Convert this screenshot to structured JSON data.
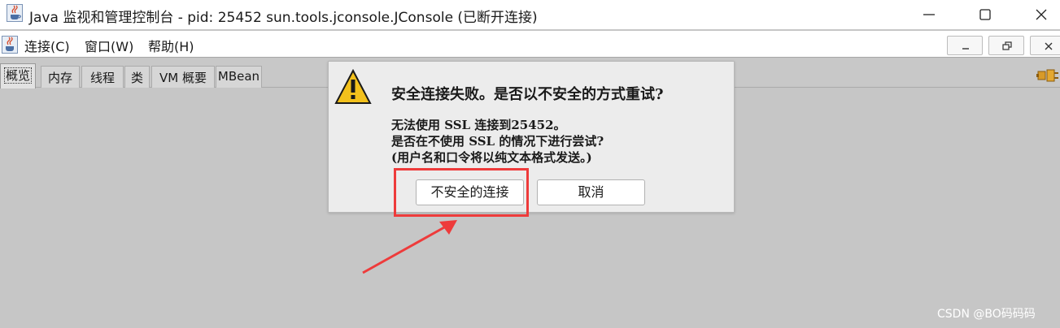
{
  "window": {
    "title": "Java 监视和管理控制台 - pid: 25452 sun.tools.jconsole.JConsole (已断开连接)",
    "app_icon": "java-cup-icon",
    "controls": [
      "minimize-icon",
      "maximize-icon",
      "close-icon"
    ]
  },
  "menubar": {
    "items": [
      {
        "label": "连接(C)"
      },
      {
        "label": "窗口(W)"
      },
      {
        "label": "帮助(H)"
      }
    ]
  },
  "tabs": [
    {
      "label": "概览",
      "active": true
    },
    {
      "label": "内存"
    },
    {
      "label": "线程"
    },
    {
      "label": "类"
    },
    {
      "label": "VM 概要"
    },
    {
      "label": "MBean"
    }
  ],
  "connection_icon": "plug-icon",
  "dialog": {
    "icon": "warning-icon",
    "title": "安全连接失败。是否以不安全的方式重试?",
    "lines": [
      "无法使用 SSL 连接到25452。",
      "是否在不使用 SSL 的情况下进行尝试?",
      "(用户名和口令将以纯文本格式发送。)"
    ],
    "buttons": {
      "insecure": "不安全的连接",
      "cancel": "取消"
    }
  },
  "annotation": {
    "color": "#ee3b3b"
  },
  "watermark": "CSDN @BO码码码"
}
